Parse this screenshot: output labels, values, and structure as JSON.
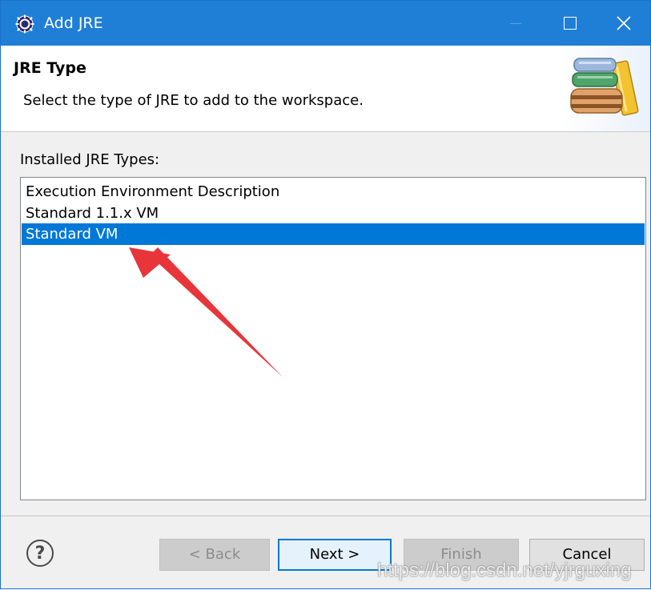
{
  "window": {
    "title": "Add JRE",
    "icon": "eclipse-gear-icon",
    "title_bar_color": "#1f7fd6"
  },
  "banner": {
    "title": "JRE Type",
    "description": "Select the type of JRE to add to the workspace.",
    "icon": "books-icon"
  },
  "jre_types": {
    "label": "Installed JRE Types:",
    "items": [
      "Execution Environment Description",
      "Standard 1.1.x VM",
      "Standard VM"
    ],
    "selected": "Standard VM",
    "selection_color": "#0078d7"
  },
  "annotation": {
    "type": "red-arrow",
    "color": "#e8353a"
  },
  "buttons": {
    "back": "< Back",
    "next": "Next >",
    "finish": "Finish",
    "cancel": "Cancel",
    "help_icon": "help-icon"
  },
  "watermark": "https://blog.csdn.net/yjrguxing"
}
